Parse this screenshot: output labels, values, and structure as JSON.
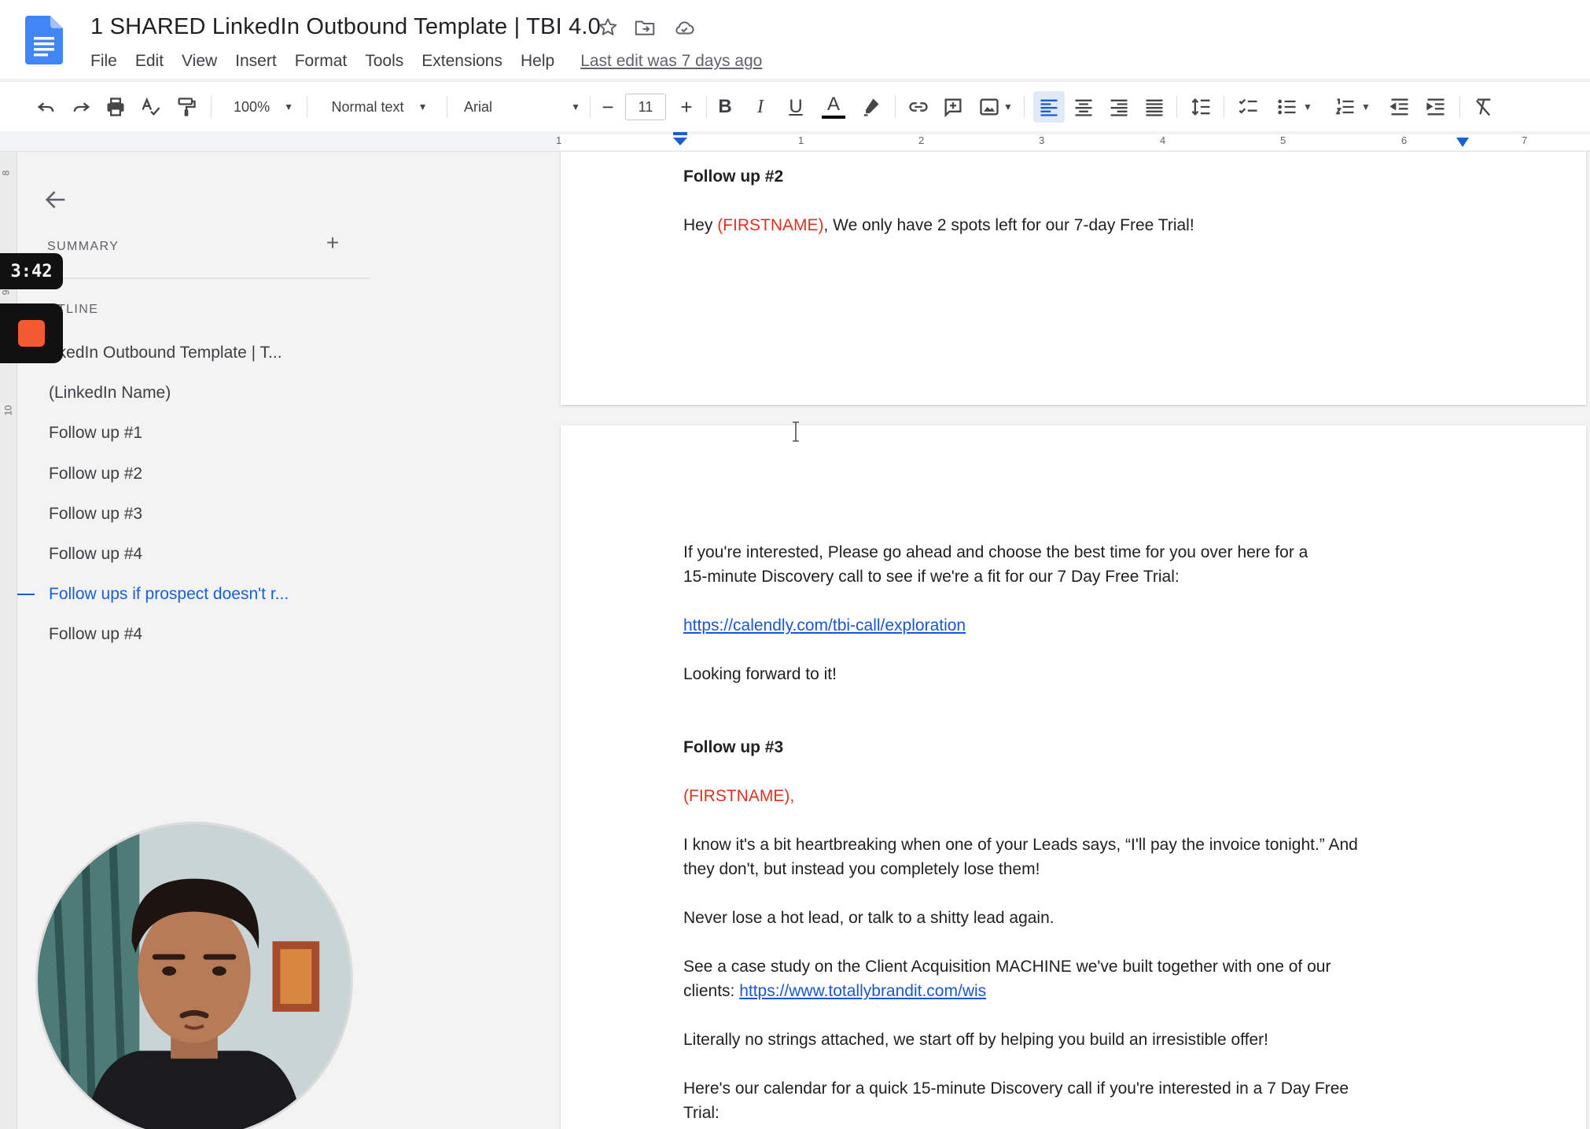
{
  "header": {
    "title": "1 SHARED LinkedIn Outbound Template | TBI 4.0",
    "last_edit": "Last edit was 7 days ago",
    "menu": [
      "File",
      "Edit",
      "View",
      "Insert",
      "Format",
      "Tools",
      "Extensions",
      "Help"
    ]
  },
  "toolbar": {
    "zoom": "100%",
    "style": "Normal text",
    "font": "Arial",
    "font_size": "11",
    "decrease_label": "−",
    "increase_label": "+",
    "bold_label": "B",
    "italic_label": "I",
    "underline_label": "U",
    "text_color_label": "A"
  },
  "ruler": {
    "numbers": [
      "1",
      "1",
      "2",
      "3",
      "4",
      "5",
      "6",
      "7"
    ]
  },
  "vruler": {
    "numbers": [
      "8",
      "9",
      "10"
    ]
  },
  "outline_panel": {
    "summary_label": "SUMMARY",
    "add_label": "+",
    "outline_label": "UTLINE",
    "items": [
      "nkedIn Outbound Template | T...",
      "(LinkedIn Name)",
      "Follow up #1",
      "Follow up #2",
      "Follow up #3",
      "Follow up #4",
      "Follow ups if prospect doesn't r...",
      "Follow up #4"
    ]
  },
  "recording": {
    "timer": "3:42"
  },
  "document": {
    "page1": {
      "heading": "Follow up #2",
      "line1_prefix": "Hey ",
      "line1_var": "(FIRSTNAME)",
      "line1_suffix": ", We only have 2 spots left for our 7-day Free Trial!"
    },
    "page2": {
      "p1_line1": "If you're interested, Please go ahead and choose the best time for you over here for a",
      "p1_line2": "15-minute Discovery call to see if we're a fit for our 7 Day Free Trial:",
      "link1": "https://calendly.com/tbi-call/exploration",
      "closing": "Looking forward to it!",
      "heading2": "Follow up #3",
      "var2": "(FIRSTNAME),",
      "p2_line1": "I know it's a bit heartbreaking when one of your Leads says, “I'll pay the invoice tonight.” And",
      "p2_line2": "they don't, but instead you completely lose them!",
      "p3": "Never lose a hot lead, or talk to a shitty lead again.",
      "p4_line1": "See a case study on the Client Acquisition MACHINE we've built together with one of our",
      "p4_line2_prefix": "clients: ",
      "link2": "https://www.totallybrandit.com/wis",
      "p5": "Literally no strings attached, we start off by helping you build an irresistible offer!",
      "p6_line1": "Here's our calendar for a quick 15-minute Discovery call if you're interested in a 7 Day Free",
      "p6_line2": "Trial:"
    }
  },
  "colors": {
    "accent": "#1a5fd2",
    "variable_red": "#e0301e",
    "link_blue": "#1a55d8",
    "record_orange": "#f25b2f"
  }
}
